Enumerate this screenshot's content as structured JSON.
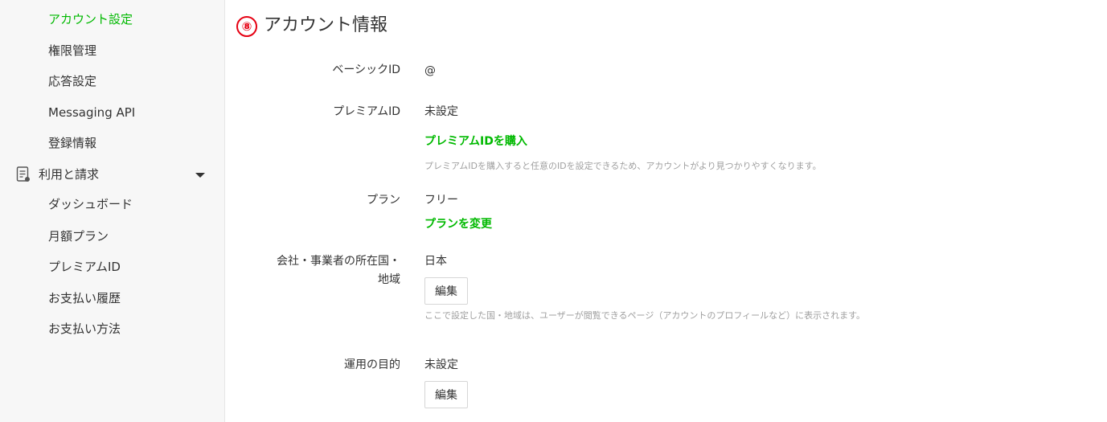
{
  "sidebar": {
    "items_top": [
      {
        "label": "アカウント設定",
        "active": true
      },
      {
        "label": "権限管理"
      },
      {
        "label": "応答設定"
      },
      {
        "label": "Messaging API"
      },
      {
        "label": "登録情報"
      }
    ],
    "group": {
      "label": "利用と請求",
      "icon": "document-icon",
      "expanded": true
    },
    "items_bottom": [
      {
        "label": "ダッシュボード"
      },
      {
        "label": "月額プラン"
      },
      {
        "label": "プレミアムID"
      },
      {
        "label": "お支払い履歴"
      },
      {
        "label": "お支払い方法"
      }
    ]
  },
  "main": {
    "badge": "⑧",
    "title": "アカウント情報",
    "basic_id": {
      "label": "ベーシックID",
      "value": "@"
    },
    "premium_id": {
      "label": "プレミアムID",
      "value": "未設定",
      "link": "プレミアムIDを購入",
      "note": "プレミアムIDを購入すると任意のIDを設定できるため、アカウントがより見つかりやすくなります。"
    },
    "plan": {
      "label": "プラン",
      "value": "フリー",
      "link": "プランを変更"
    },
    "country": {
      "label_line1": "会社・事業者の所在国・",
      "label_line2": "地域",
      "value": "日本",
      "button": "編集",
      "note": "ここで設定した国・地域は、ユーザーが閲覧できるページ（アカウントのプロフィールなど）に表示されます。"
    },
    "purpose": {
      "label": "運用の目的",
      "value": "未設定",
      "button": "編集"
    }
  },
  "colors": {
    "accent": "#00b900",
    "badge": "#e60012",
    "sidebar_bg": "#f7f7f7"
  }
}
